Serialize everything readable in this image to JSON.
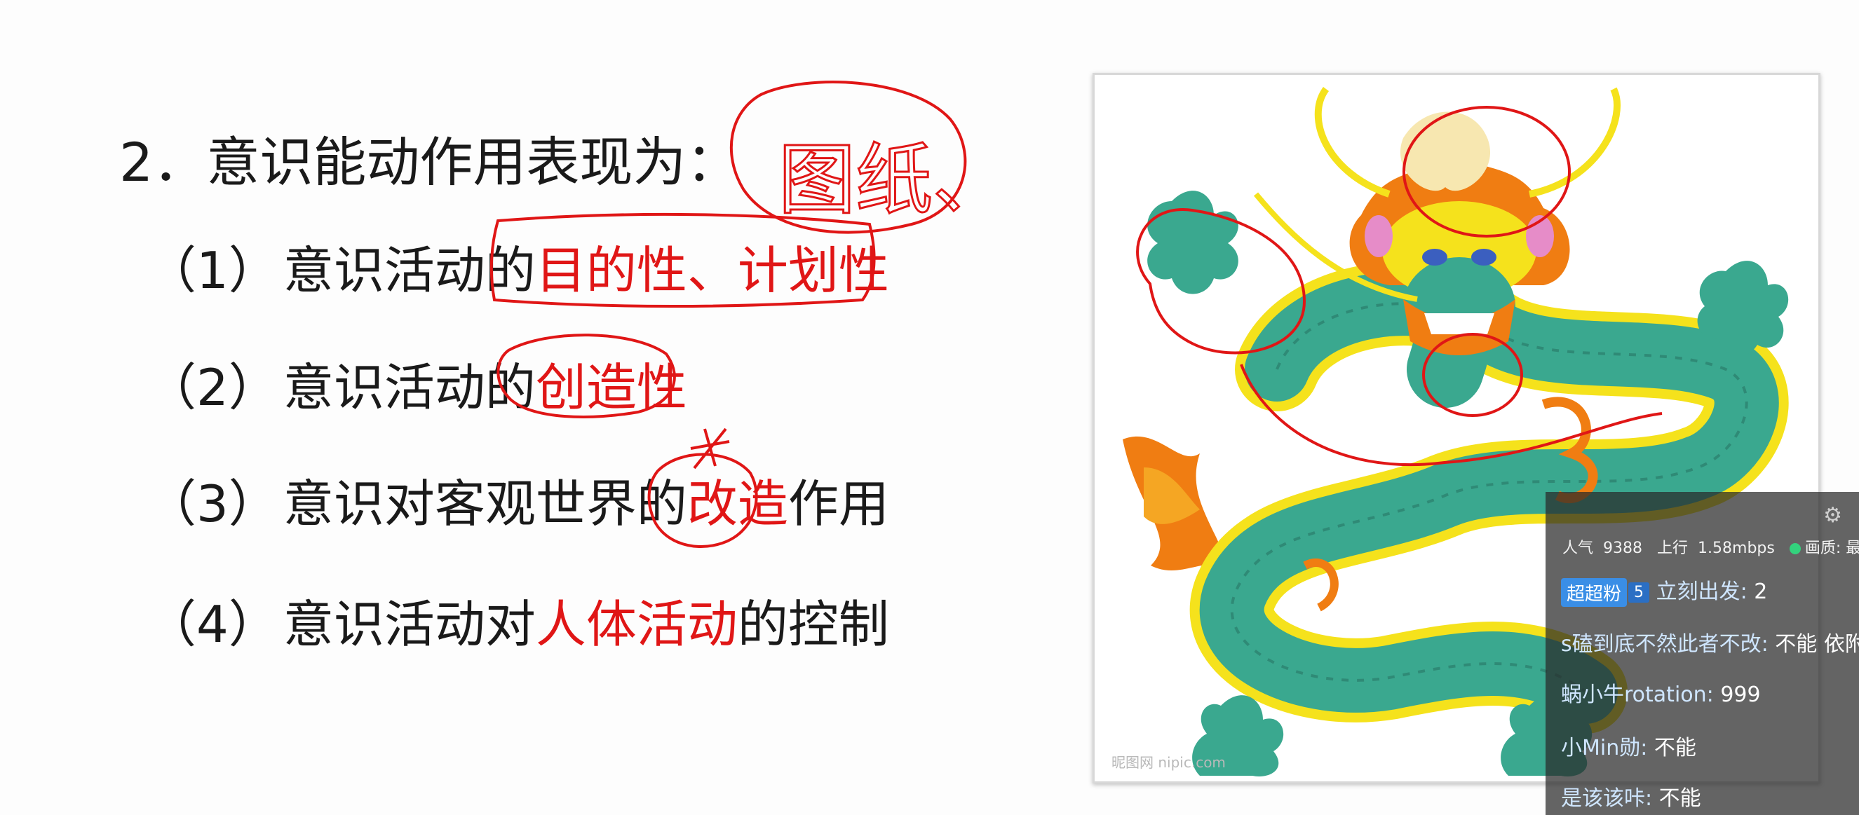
{
  "slide": {
    "heading": "2．意识能动作用表现为：",
    "items": [
      {
        "num": "（1）",
        "plain": "意识活动的",
        "red": "目的性、计划性",
        "tail": ""
      },
      {
        "num": "（2）",
        "plain": "意识活动的",
        "red": "创造性",
        "tail": ""
      },
      {
        "num": "（3）",
        "plain": "意识对客观世界的",
        "red": "改造",
        "tail": "作用"
      },
      {
        "num": "（4）",
        "plain": "意识活动对",
        "red": "人体活动",
        "tail": "的控制"
      }
    ],
    "handwriting_note": "图纸、"
  },
  "image": {
    "icon": "chinese-dragon-illustration",
    "watermark": "昵图网 nipic.com"
  },
  "live_panel": {
    "popularity_label": "人气",
    "popularity_value": "9388",
    "upload_label": "上行",
    "upload_value": "1.58mbps",
    "quality_label": "画质: 最佳",
    "messages": [
      {
        "badge": "超超粉",
        "level": "5",
        "user": "立刻出发",
        "text": "2"
      },
      {
        "badge": "",
        "level": "",
        "user": "s磕到底不然此者不改",
        "text": "不能  依附"
      },
      {
        "badge": "",
        "level": "",
        "user": "蜗小牛rotation",
        "text": "999"
      },
      {
        "badge": "",
        "level": "",
        "user": "小Min勋",
        "text": "不能"
      },
      {
        "badge": "",
        "level": "",
        "user": "是该该咔",
        "text": "不能"
      }
    ]
  },
  "colors": {
    "annotation_red": "#e01616",
    "text_dark": "#1a1a1a",
    "dragon_green": "#3aa88f",
    "dragon_orange": "#f07d12",
    "dragon_yellow": "#f5e21c"
  }
}
